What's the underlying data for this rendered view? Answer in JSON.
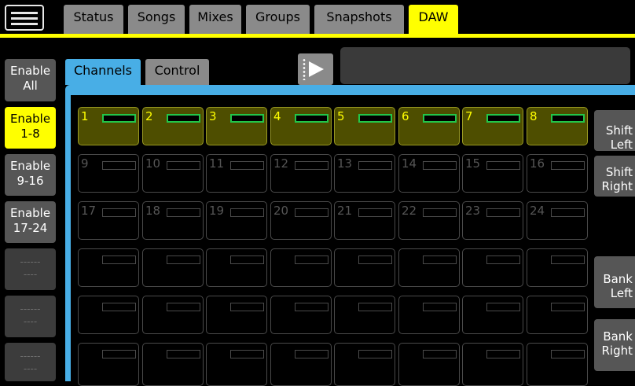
{
  "top_tabs": [
    {
      "label": "Status",
      "active": false
    },
    {
      "label": "Songs",
      "active": false
    },
    {
      "label": "Mixes",
      "active": false
    },
    {
      "label": "Groups",
      "active": false
    },
    {
      "label": "Snapshots",
      "active": false
    },
    {
      "label": "DAW",
      "active": true
    }
  ],
  "side_buttons": [
    {
      "line1": "Enable",
      "line2": "All",
      "state": "normal"
    },
    {
      "line1": "Enable",
      "line2": "1-8",
      "state": "active"
    },
    {
      "line1": "Enable",
      "line2": "9-16",
      "state": "normal"
    },
    {
      "line1": "Enable",
      "line2": "17-24",
      "state": "normal"
    },
    {
      "line1": "------",
      "line2": "----",
      "state": "disabled"
    },
    {
      "line1": "------",
      "line2": "----",
      "state": "disabled"
    },
    {
      "line1": "------",
      "line2": "----",
      "state": "disabled"
    }
  ],
  "channel_tabs": [
    {
      "label": "Channels",
      "active": true
    },
    {
      "label": "Control",
      "active": false
    }
  ],
  "daw_display_text": "",
  "channel_rows": [
    [
      {
        "num": "1",
        "on": true
      },
      {
        "num": "2",
        "on": true
      },
      {
        "num": "3",
        "on": true
      },
      {
        "num": "4",
        "on": true
      },
      {
        "num": "5",
        "on": true
      },
      {
        "num": "6",
        "on": true
      },
      {
        "num": "7",
        "on": true
      },
      {
        "num": "8",
        "on": true
      }
    ],
    [
      {
        "num": "9",
        "on": false
      },
      {
        "num": "10",
        "on": false
      },
      {
        "num": "11",
        "on": false
      },
      {
        "num": "12",
        "on": false
      },
      {
        "num": "13",
        "on": false
      },
      {
        "num": "14",
        "on": false
      },
      {
        "num": "15",
        "on": false
      },
      {
        "num": "16",
        "on": false
      }
    ],
    [
      {
        "num": "17",
        "on": false
      },
      {
        "num": "18",
        "on": false
      },
      {
        "num": "19",
        "on": false
      },
      {
        "num": "20",
        "on": false
      },
      {
        "num": "21",
        "on": false
      },
      {
        "num": "22",
        "on": false
      },
      {
        "num": "23",
        "on": false
      },
      {
        "num": "24",
        "on": false
      }
    ],
    [
      {
        "num": "",
        "on": false
      },
      {
        "num": "",
        "on": false
      },
      {
        "num": "",
        "on": false
      },
      {
        "num": "",
        "on": false
      },
      {
        "num": "",
        "on": false
      },
      {
        "num": "",
        "on": false
      },
      {
        "num": "",
        "on": false
      },
      {
        "num": "",
        "on": false
      }
    ],
    [
      {
        "num": "",
        "on": false
      },
      {
        "num": "",
        "on": false
      },
      {
        "num": "",
        "on": false
      },
      {
        "num": "",
        "on": false
      },
      {
        "num": "",
        "on": false
      },
      {
        "num": "",
        "on": false
      },
      {
        "num": "",
        "on": false
      },
      {
        "num": "",
        "on": false
      }
    ],
    [
      {
        "num": "",
        "on": false
      },
      {
        "num": "",
        "on": false
      },
      {
        "num": "",
        "on": false
      },
      {
        "num": "",
        "on": false
      },
      {
        "num": "",
        "on": false
      },
      {
        "num": "",
        "on": false
      },
      {
        "num": "",
        "on": false
      },
      {
        "num": "",
        "on": false
      }
    ]
  ],
  "right_buttons": [
    {
      "line1": "Shift",
      "line2": "Left"
    },
    {
      "line1": "Shift",
      "line2": "Right"
    },
    {
      "line1": "Bank",
      "line2": "Left"
    },
    {
      "line1": "Bank",
      "line2": "Right"
    }
  ],
  "icons": {
    "menu": "hamburger-menu-icon",
    "play": "play-icon"
  },
  "colors": {
    "accent": "#ffff00",
    "panel": "#48aee6",
    "meter": "#22c64a"
  }
}
